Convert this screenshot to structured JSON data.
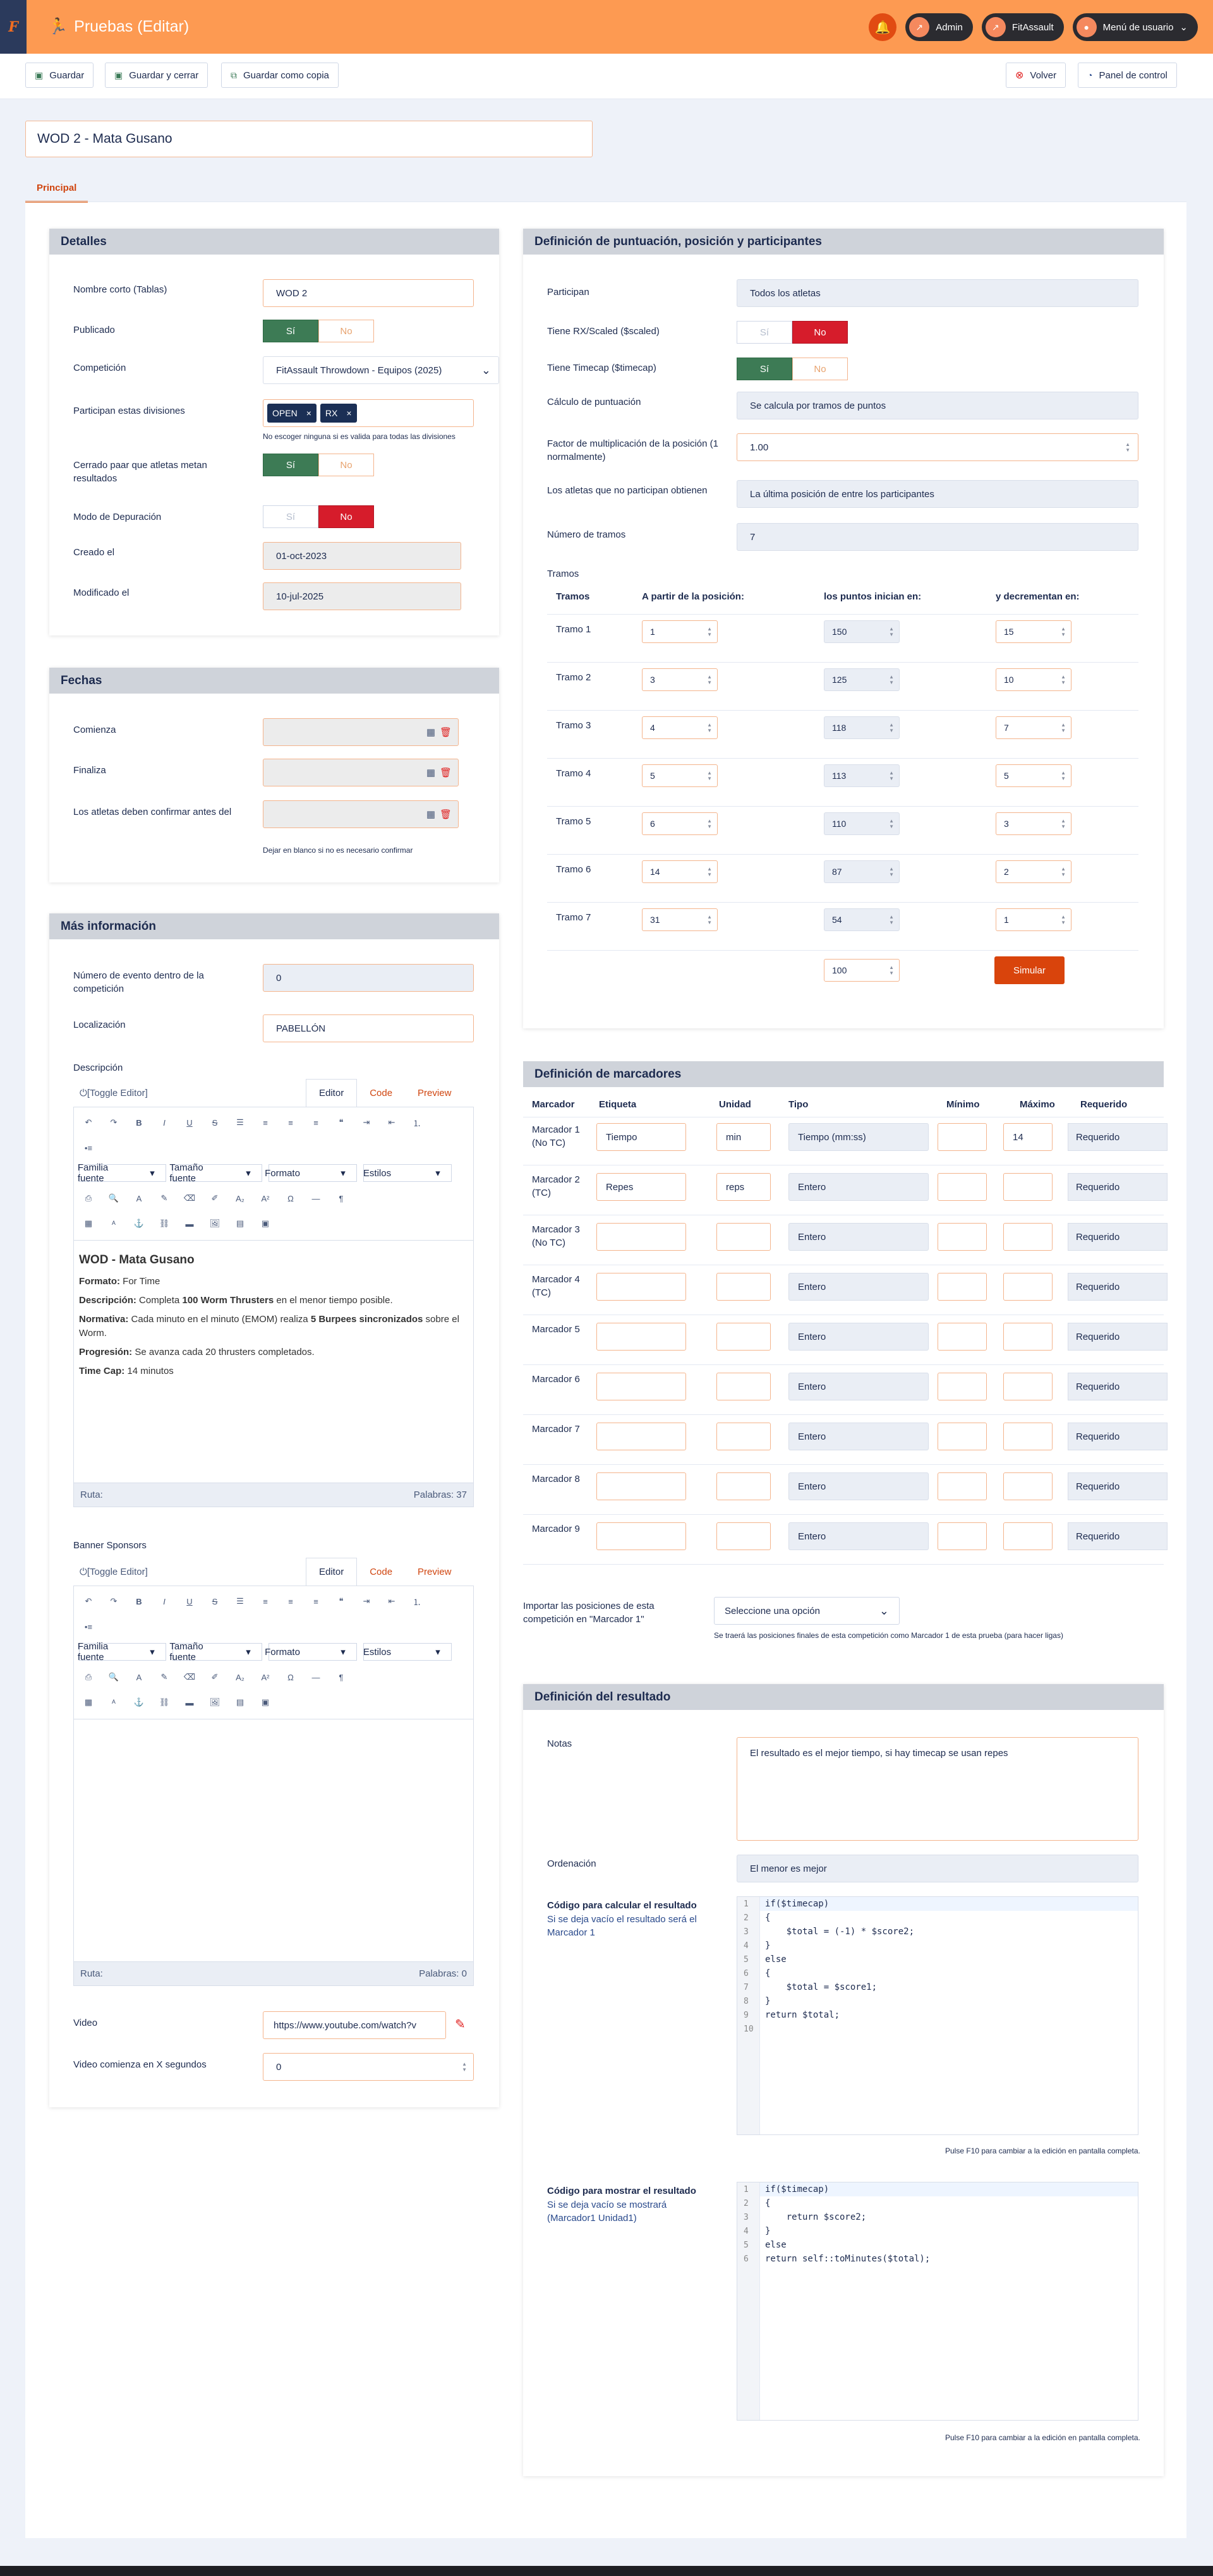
{
  "header": {
    "app": "F",
    "title": "Pruebas (Editar)",
    "admin": "Admin",
    "site": "FitAssault",
    "user_menu": "Menú de usuario"
  },
  "toolbar": {
    "save": "Guardar",
    "save_close": "Guardar y cerrar",
    "save_copy": "Guardar como copia",
    "back": "Volver",
    "panel": "Panel de control"
  },
  "title_value": "WOD 2 - Mata Gusano",
  "tab_main": "Principal",
  "details": {
    "legend": "Detalles",
    "short_name_label": "Nombre corto (Tablas)",
    "short_name": "WOD 2",
    "published_label": "Publicado",
    "yes": "Sí",
    "no": "No",
    "competition_label": "Competición",
    "competition": "FitAssault Throwdown - Equipos (2025)",
    "divisions_label": "Participan estas divisiones",
    "divisions": [
      "OPEN",
      "RX"
    ],
    "divisions_hint": "No escoger ninguna si es valida para todas las divisiones",
    "closed_label": "Cerrado paar que atletas metan resultados",
    "debug_label": "Modo de Depuración",
    "created_label": "Creado el",
    "created": "01-oct-2023",
    "modified_label": "Modificado el",
    "modified": "10-jul-2025"
  },
  "dates": {
    "legend": "Fechas",
    "start": "Comienza",
    "end": "Finaliza",
    "confirm": "Los atletas deben confirmar antes del",
    "hint": "Dejar en blanco si no es necesario confirmar"
  },
  "more": {
    "legend": "Más información",
    "event_num_label": "Número de evento dentro de la competición",
    "event_num": "0",
    "location_label": "Localización",
    "location": "PABELLÓN",
    "desc_label": "Descripción",
    "banner_label": "Banner Sponsors",
    "video_label": "Video",
    "video": "https://www.youtube.com/watch?v",
    "video_start_label": "Video comienza en X segundos",
    "video_start": "0"
  },
  "editor": {
    "toggle": "[Toggle Editor]",
    "tab_editor": "Editor",
    "tab_code": "Code",
    "tab_preview": "Preview",
    "font": "Familia fuente",
    "size": "Tamaño fuente",
    "format": "Formato",
    "styles": "Estilos",
    "path": "Ruta:",
    "words1": "Palabras: 37",
    "words2": "Palabras: 0"
  },
  "desc": {
    "title": "WOD - Mata Gusano",
    "l1a": "Formato:",
    "l1b": " For Time",
    "l2a": "Descripción:",
    "l2b": " Completa ",
    "l2c": "100 Worm Thrusters",
    "l2d": " en el menor tiempo posible.",
    "l3a": "Normativa:",
    "l3b": " Cada minuto en el minuto (EMOM) realiza ",
    "l3c": "5 Burpees sincronizados",
    "l3d": " sobre el Worm.",
    "l4a": "Progresión:",
    "l4b": " Se avanza cada 20 thrusters completados.",
    "l5a": "Time Cap:",
    "l5b": " 14 minutos"
  },
  "scoring": {
    "legend": "Definición de puntuación, posición y participantes",
    "participate_label": "Participan",
    "participate": "Todos los atletas",
    "rx_label": "Tiene RX/Scaled ($scaled)",
    "timecap_label": "Tiene Timecap ($timecap)",
    "calc_label": "Cálculo de puntuación",
    "calc": "Se calcula por tramos de puntos",
    "factor_label": "Factor de multiplicación de la posición (1 normalmente)",
    "factor": "1.00",
    "nonpart_label": "Los atletas que no participan obtienen",
    "nonpart": "La última posición de entre los participantes",
    "tramos_num_label": "Número de tramos",
    "tramos_num": "7",
    "tramos_label": "Tramos",
    "th": [
      "Tramos",
      "A partir de la posición:",
      "los puntos inician en:",
      "y decrementan en:"
    ],
    "rows": [
      {
        "name": "Tramo 1",
        "from": "1",
        "start": "150",
        "dec": "15"
      },
      {
        "name": "Tramo 2",
        "from": "3",
        "start": "125",
        "dec": "10"
      },
      {
        "name": "Tramo 3",
        "from": "4",
        "start": "118",
        "dec": "7"
      },
      {
        "name": "Tramo 4",
        "from": "5",
        "start": "113",
        "dec": "5"
      },
      {
        "name": "Tramo 5",
        "from": "6",
        "start": "110",
        "dec": "3"
      },
      {
        "name": "Tramo 6",
        "from": "14",
        "start": "87",
        "dec": "2"
      },
      {
        "name": "Tramo 7",
        "from": "31",
        "start": "54",
        "dec": "1"
      }
    ],
    "sim_value": "100",
    "simulate": "Simular"
  },
  "markers": {
    "legend": "Definición de marcadores",
    "th": [
      "Marcador",
      "Etiqueta",
      "Unidad",
      "Tipo",
      "Mínimo",
      "Máximo",
      "Requerido"
    ],
    "rows": [
      {
        "name": "Marcador 1 (No TC)",
        "label": "Tiempo",
        "unit": "min",
        "type": "Tiempo (mm:ss)",
        "min": "",
        "max": "14",
        "req": "Requerido"
      },
      {
        "name": "Marcador 2 (TC)",
        "label": "Repes",
        "unit": "reps",
        "type": "Entero",
        "min": "",
        "max": "",
        "req": "Requerido"
      },
      {
        "name": "Marcador 3 (No TC)",
        "label": "",
        "unit": "",
        "type": "Entero",
        "min": "",
        "max": "",
        "req": "Requerido"
      },
      {
        "name": "Marcador 4 (TC)",
        "label": "",
        "unit": "",
        "type": "Entero",
        "min": "",
        "max": "",
        "req": "Requerido"
      },
      {
        "name": "Marcador 5",
        "label": "",
        "unit": "",
        "type": "Entero",
        "min": "",
        "max": "",
        "req": "Requerido"
      },
      {
        "name": "Marcador 6",
        "label": "",
        "unit": "",
        "type": "Entero",
        "min": "",
        "max": "",
        "req": "Requerido"
      },
      {
        "name": "Marcador 7",
        "label": "",
        "unit": "",
        "type": "Entero",
        "min": "",
        "max": "",
        "req": "Requerido"
      },
      {
        "name": "Marcador 8",
        "label": "",
        "unit": "",
        "type": "Entero",
        "min": "",
        "max": "",
        "req": "Requerido"
      },
      {
        "name": "Marcador 9",
        "label": "",
        "unit": "",
        "type": "Entero",
        "min": "",
        "max": "",
        "req": "Requerido"
      }
    ],
    "import_label": "Importar las posiciones de esta competición en \"Marcador 1\"",
    "import_select": "Seleccione una opción",
    "import_hint": "Se traerá las posiciones finales de esta competición como Marcador 1 de esta prueba (para hacer ligas)"
  },
  "result": {
    "legend": "Definición del resultado",
    "notes_label": "Notas",
    "notes": "El resultado es el mejor tiempo, si hay timecap se usan repes",
    "order_label": "Ordenación",
    "order": "El menor es mejor",
    "calc_label": "Código para calcular el resultado",
    "calc_sub": "Si se deja vacío el resultado será el Marcador 1",
    "calc_code": [
      "if($timecap)",
      "{",
      "    $total = (-1) * $score2;",
      "}",
      "else",
      "{",
      "    $total = $score1;",
      "}",
      "return $total;",
      ""
    ],
    "show_label": "Código para mostrar el resultado",
    "show_sub": "Si se deja vacío se mostrará (Marcador1 Unidad1)",
    "show_code": [
      "if($timecap)",
      "{",
      "    return $score2;",
      "}",
      "else",
      "return self::toMinutes($total);"
    ],
    "f10": "Pulse F10 para cambiar a la edición en pantalla completa."
  }
}
